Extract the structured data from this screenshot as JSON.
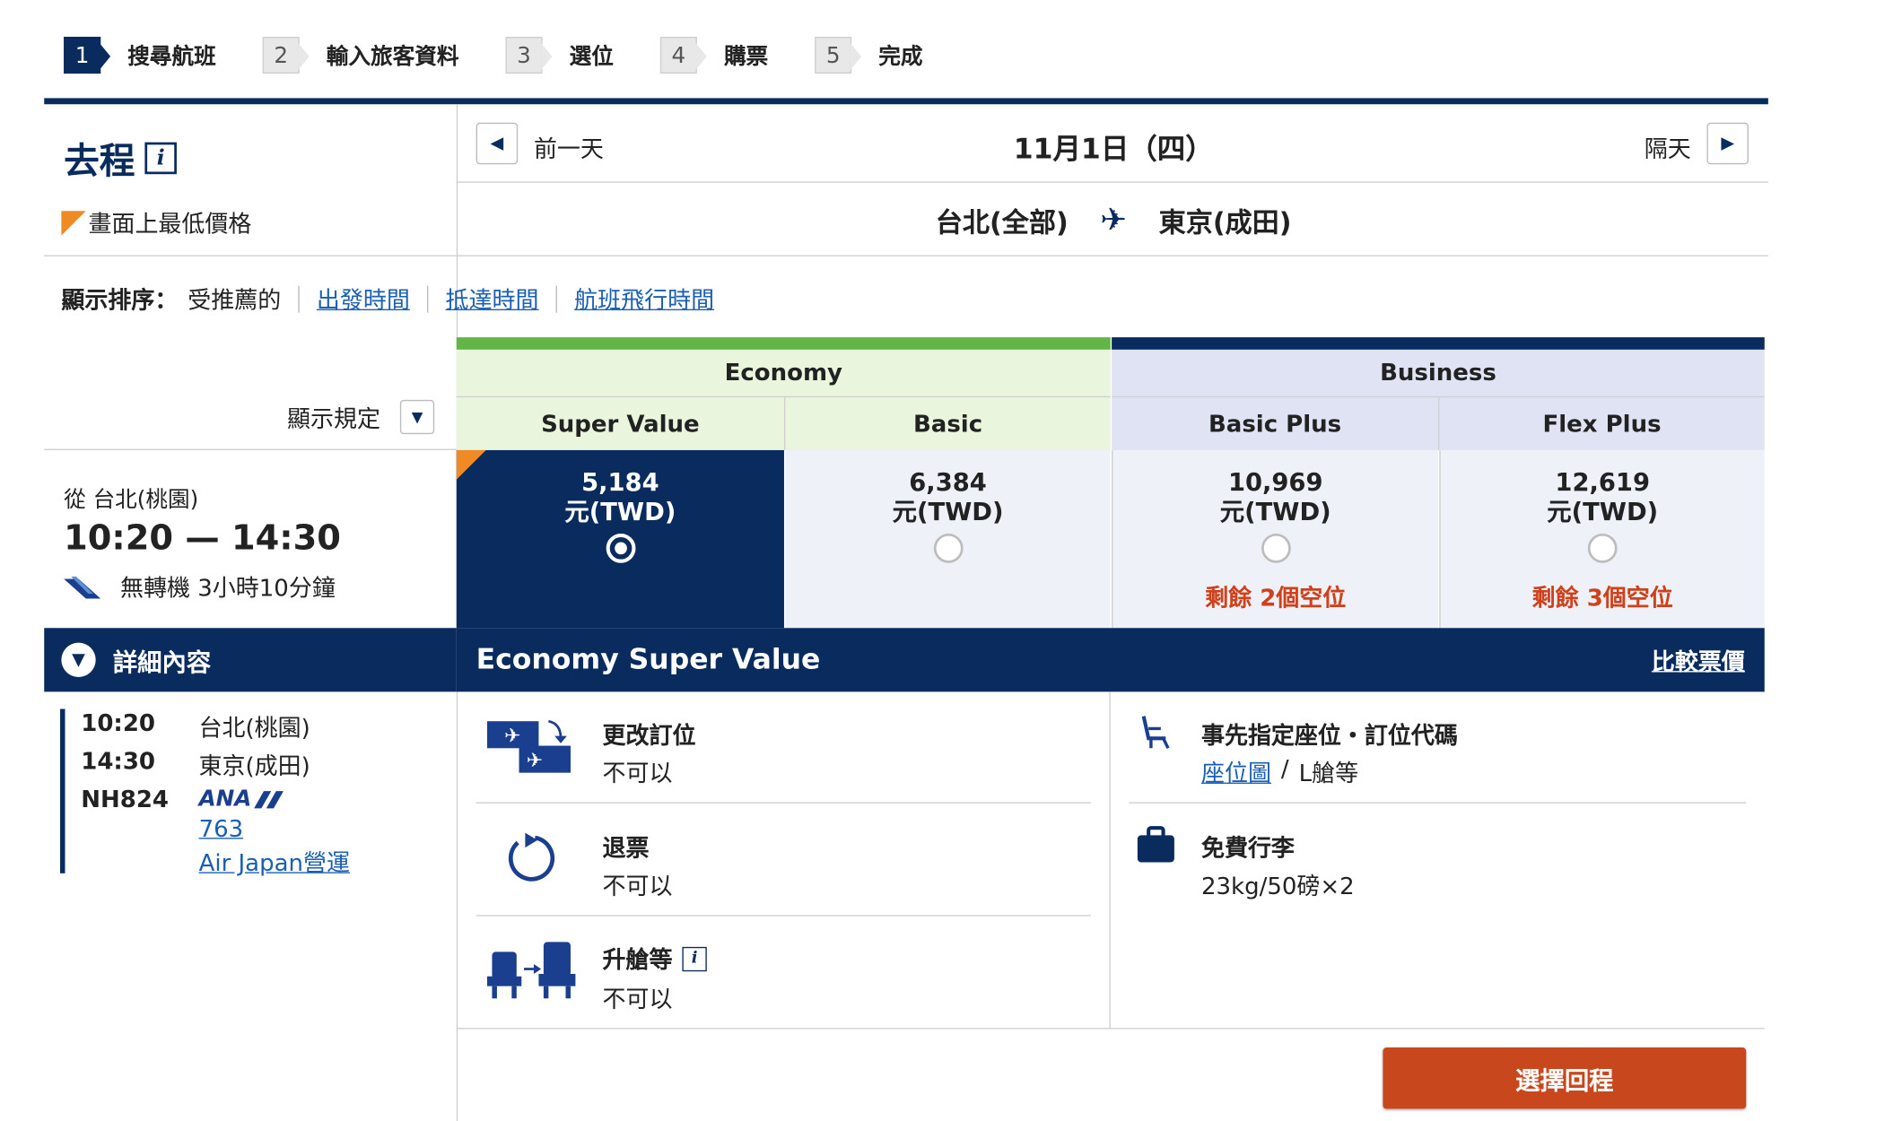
{
  "steps": [
    {
      "num": "1",
      "label": "搜尋航班"
    },
    {
      "num": "2",
      "label": "輸入旅客資料"
    },
    {
      "num": "3",
      "label": "選位"
    },
    {
      "num": "4",
      "label": "購票"
    },
    {
      "num": "5",
      "label": "完成"
    }
  ],
  "active_step": "1",
  "header": {
    "title": "去程",
    "info_icon": "i",
    "lowest_price_note": "畫面上最低價格"
  },
  "date_nav": {
    "prev_label": "前一天",
    "date": "11月1日（四）",
    "next_label": "隔天"
  },
  "route": {
    "from": "台北(全部)",
    "to": "東京(成田)"
  },
  "sort": {
    "label": "顯示排序：",
    "options": [
      "受推薦的",
      "出發時間",
      "抵達時間",
      "航班飛行時間"
    ]
  },
  "display_rule_label": "顯示規定",
  "cabins": {
    "economy": "Economy",
    "business": "Business"
  },
  "fares": [
    {
      "name": "Super Value",
      "price": "5,184",
      "currency": "元(TWD)",
      "seats": "",
      "selected": true
    },
    {
      "name": "Basic",
      "price": "6,384",
      "currency": "元(TWD)",
      "seats": "",
      "selected": false
    },
    {
      "name": "Basic Plus",
      "price": "10,969",
      "currency": "元(TWD)",
      "seats": "剩餘 2個空位",
      "selected": false
    },
    {
      "name": "Flex Plus",
      "price": "12,619",
      "currency": "元(TWD)",
      "seats": "剩餘 3個空位",
      "selected": false
    }
  ],
  "flight": {
    "from_label": "從 台北(桃園)",
    "times": "10:20 — 14:30",
    "nonstop": "無轉機 3小時10分鐘",
    "airline_icon": "ana-logo-icon"
  },
  "details_label": "詳細內容",
  "segment": {
    "dep_time": "10:20",
    "dep_airport": "台北(桃園)",
    "arr_time": "14:30",
    "arr_airport": "東京(成田)",
    "flight_no": "NH824",
    "airline": "ANA",
    "aircraft": "763",
    "operator": "Air Japan營運"
  },
  "selected_fare_title": "Economy Super Value",
  "compare_link": "比較票價",
  "rules": {
    "change": {
      "title": "更改訂位",
      "value": "不可以"
    },
    "refund": {
      "title": "退票",
      "value": "不可以"
    },
    "upgrade": {
      "title": "升艙等",
      "value": "不可以"
    },
    "seat": {
      "title": "事先指定座位・訂位代碼",
      "seat_map_link": "座位圖",
      "separator": "/",
      "class_code": "L艙等"
    },
    "baggage": {
      "title": "免費行李",
      "value": "23kg/50磅×2"
    }
  },
  "cta_label": "選擇回程",
  "colors": {
    "navy": "#0a2b5e",
    "economy_green": "#63b546",
    "economy_bg": "#e9f5dd",
    "business_bg": "#e0e3f3",
    "accent_orange": "#f08a24",
    "cta_red": "#c9471c",
    "seat_warning": "#d0401a"
  }
}
